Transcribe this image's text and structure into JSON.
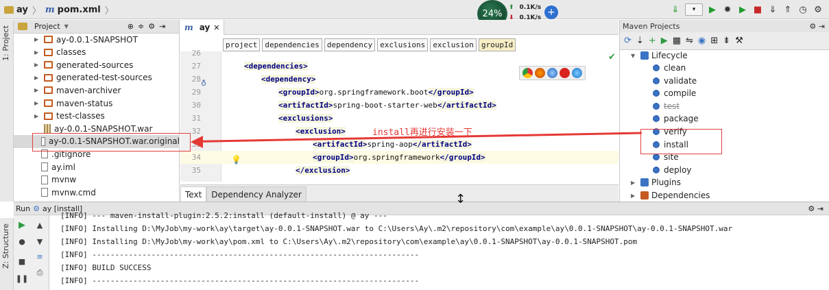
{
  "nav": {
    "crumb1": "ay",
    "crumb2": "pom.xml"
  },
  "speed": {
    "percent": "24%",
    "up": "0.1K/s",
    "down": "0.1K/s"
  },
  "left_tabs": {
    "project": "1: Project",
    "structure": "Z: Structure"
  },
  "project_panel": {
    "title": "Project",
    "items": [
      {
        "label": "ay-0.0.1-SNAPSHOT",
        "kind": "dir"
      },
      {
        "label": "classes",
        "kind": "dir"
      },
      {
        "label": "generated-sources",
        "kind": "dir"
      },
      {
        "label": "generated-test-sources",
        "kind": "dir"
      },
      {
        "label": "maven-archiver",
        "kind": "dir"
      },
      {
        "label": "maven-status",
        "kind": "dir"
      },
      {
        "label": "test-classes",
        "kind": "dir"
      },
      {
        "label": "ay-0.0.1-SNAPSHOT.war",
        "kind": "war"
      },
      {
        "label": "ay-0.0.1-SNAPSHOT.war.original",
        "kind": "file"
      },
      {
        "label": ".gitignore",
        "kind": "file"
      },
      {
        "label": "ay.iml",
        "kind": "file"
      },
      {
        "label": "mvnw",
        "kind": "file"
      },
      {
        "label": "mvnw.cmd",
        "kind": "file"
      }
    ]
  },
  "editor": {
    "tab_label": "ay",
    "crumbs": [
      "project",
      "dependencies",
      "dependency",
      "exclusions",
      "exclusion",
      "groupId"
    ],
    "lines": [
      {
        "n": "26",
        "tag1": "",
        "text": "",
        "tag2": ""
      },
      {
        "n": "27",
        "tag1": "<dependencies>",
        "text": "",
        "tag2": ""
      },
      {
        "n": "28",
        "tag1": "<dependency>",
        "text": "",
        "tag2": ""
      },
      {
        "n": "29",
        "tag1": "<groupId>",
        "text": "org.springframework.boot",
        "tag2": "</groupId>"
      },
      {
        "n": "30",
        "tag1": "<artifactId>",
        "text": "spring-boot-starter-web",
        "tag2": "</artifactId>"
      },
      {
        "n": "31",
        "tag1": "<exclusions>",
        "text": "",
        "tag2": ""
      },
      {
        "n": "32",
        "tag1": "<exclusion>",
        "text": "",
        "tag2": ""
      },
      {
        "n": "33",
        "tag1": "<artifactId>",
        "text": "spring-aop",
        "tag2": "</artifactId>"
      },
      {
        "n": "34",
        "tag1": "<groupId>",
        "text": "org.springframework",
        "tag2": "</groupId>"
      },
      {
        "n": "35",
        "tag1": "</exclusion>",
        "text": "",
        "tag2": ""
      }
    ],
    "bottom_tabs": [
      "Text",
      "Dependency Analyzer"
    ]
  },
  "maven": {
    "title": "Maven Projects",
    "lifecycle": "Lifecycle",
    "goals": [
      "clean",
      "validate",
      "compile",
      "test",
      "package",
      "verify",
      "install",
      "site",
      "deploy"
    ],
    "plugins": "Plugins",
    "dependencies": "Dependencies"
  },
  "run": {
    "title": "Run",
    "config": "ay [install]",
    "lines": [
      "[INFO] --- maven-install-plugin:2.5.2:install (default-install) @ ay ---",
      "[INFO] Installing D:\\MyJob\\my-work\\ay\\target\\ay-0.0.1-SNAPSHOT.war to C:\\Users\\Ay\\.m2\\repository\\com\\example\\ay\\0.0.1-SNAPSHOT\\ay-0.0.1-SNAPSHOT.war",
      "[INFO] Installing D:\\MyJob\\my-work\\ay\\pom.xml to C:\\Users\\Ay\\.m2\\repository\\com\\example\\ay\\0.0.1-SNAPSHOT\\ay-0.0.1-SNAPSHOT.pom",
      "[INFO] ------------------------------------------------------------------------",
      "[INFO] BUILD SUCCESS",
      "[INFO] ------------------------------------------------------------------------"
    ]
  },
  "annotation": {
    "text": "install再进行安装一下"
  },
  "colors": {
    "annotation": "#e53935",
    "tag": "#000080",
    "accent": "#3b74c4"
  }
}
